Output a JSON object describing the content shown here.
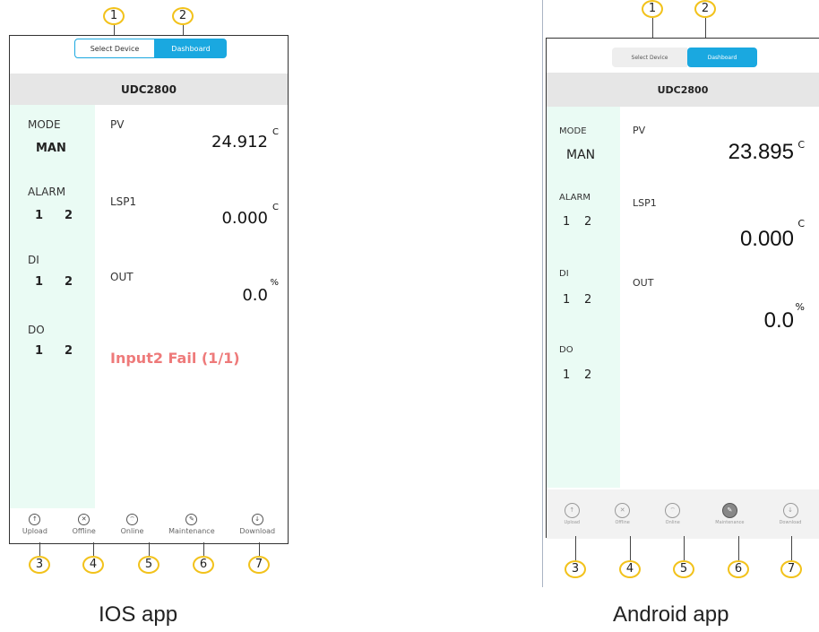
{
  "callouts": {
    "c1": "1",
    "c2": "2",
    "c3": "3",
    "c4": "4",
    "c5": "5",
    "c6": "6",
    "c7": "7"
  },
  "ios": {
    "tabs": {
      "select_device": "Select Device",
      "dashboard": "Dashboard"
    },
    "device_name": "UDC2800",
    "mode_label": "MODE",
    "mode_value": "MAN",
    "alarm_label": "ALARM",
    "alarm_1": "1",
    "alarm_2": "2",
    "di_label": "DI",
    "di_1": "1",
    "di_2": "2",
    "do_label": "DO",
    "do_1": "1",
    "do_2": "2",
    "pv_label": "PV",
    "pv_value": "24.912",
    "pv_unit": "C",
    "lsp1_label": "LSP1",
    "lsp1_value": "0.000",
    "lsp1_unit": "C",
    "out_label": "OUT",
    "out_value": "0.0",
    "out_unit": "%",
    "fail_text": "Input2 Fail (1/1)",
    "bottom": {
      "upload": "Upload",
      "offline": "Offline",
      "online": "Online",
      "maintenance": "Maintenance",
      "download": "Download"
    }
  },
  "android": {
    "tabs": {
      "select_device": "Select Device",
      "dashboard": "Dashboard"
    },
    "device_name": "UDC2800",
    "mode_label": "MODE",
    "mode_value": "MAN",
    "alarm_label": "ALARM",
    "alarm_1": "1",
    "alarm_2": "2",
    "di_label": "DI",
    "di_1": "1",
    "di_2": "2",
    "do_label": "DO",
    "do_1": "1",
    "do_2": "2",
    "pv_label": "PV",
    "pv_value": "23.895",
    "pv_unit": "C",
    "lsp1_label": "LSP1",
    "lsp1_value": "0.000",
    "lsp1_unit": "C",
    "out_label": "OUT",
    "out_value": "0.0",
    "out_unit": "%",
    "bottom": {
      "upload": "Upload",
      "offline": "Offline",
      "online": "Online",
      "maintenance": "Maintenance",
      "download": "Download"
    }
  },
  "captions": {
    "ios": "IOS app",
    "android": "Android app"
  },
  "colors": {
    "accent": "#1aa8e0",
    "callout": "#f2c21b",
    "sidebar": "#eafbf4",
    "fail": "#ee7a7a"
  }
}
